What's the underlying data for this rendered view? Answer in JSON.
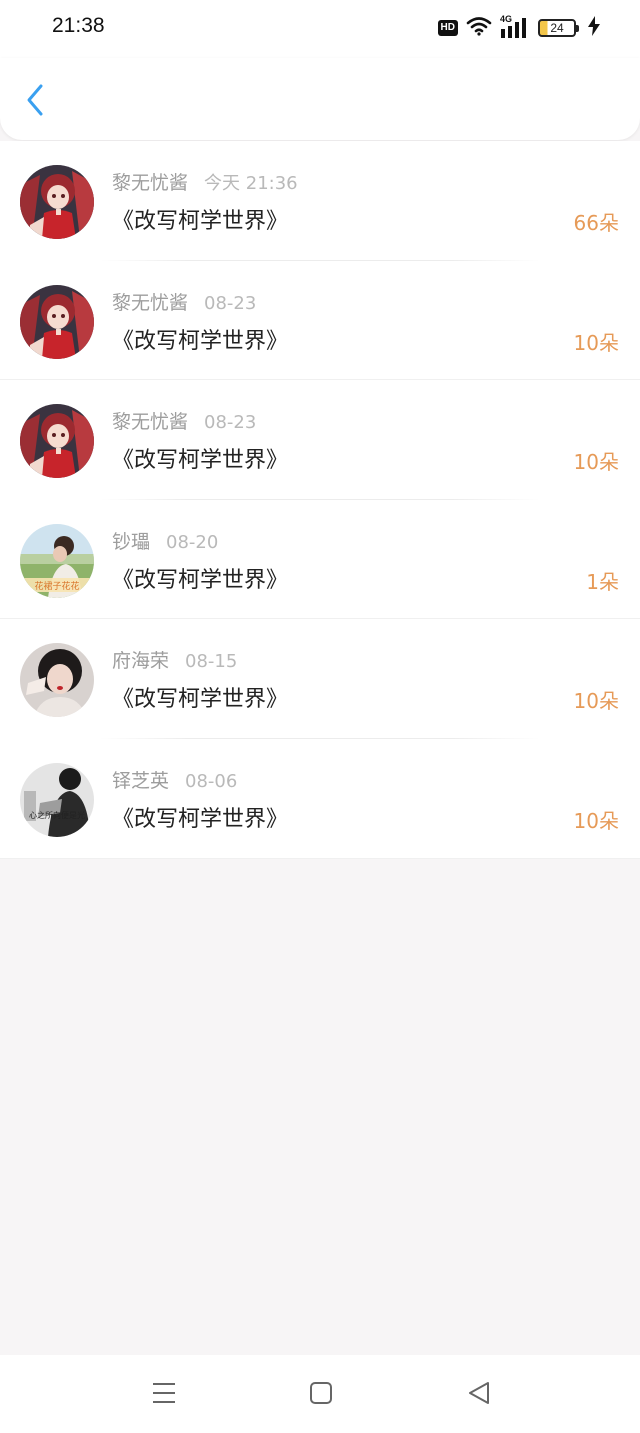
{
  "status_bar": {
    "time": "21:38",
    "hd_label": "HD",
    "network_label": "4G",
    "battery_level": "24",
    "icons": [
      "hd-icon",
      "wifi-icon",
      "signal-4g-icon",
      "battery-icon",
      "charging-bolt-icon"
    ]
  },
  "header": {
    "back_icon": "chevron-left-icon",
    "accent_color": "#3aa0f0"
  },
  "colors": {
    "amount": "#e69a57",
    "meta_text": "#9d9d9d",
    "background": "#f7f5f6"
  },
  "rows": [
    {
      "name": "黎无忧酱",
      "date": "今天 21:36",
      "title": "《改写柯学世界》",
      "amount": "66朵",
      "avatar": "avatar-anime-red"
    },
    {
      "name": "黎无忧酱",
      "date": "08-23",
      "title": "《改写柯学世界》",
      "amount": "10朵",
      "avatar": "avatar-anime-red"
    },
    {
      "name": "黎无忧酱",
      "date": "08-23",
      "title": "《改写柯学世界》",
      "amount": "10朵",
      "avatar": "avatar-anime-red"
    },
    {
      "name": "钞瓃",
      "date": "08-20",
      "title": "《改写柯学世界》",
      "amount": "1朵",
      "avatar": "avatar-photo-girl-outdoor",
      "avatar_caption": "花裙子花花"
    },
    {
      "name": "府海荣",
      "date": "08-15",
      "title": "《改写柯学世界》",
      "amount": "10朵",
      "avatar": "avatar-photo-girl-dark"
    },
    {
      "name": "铎芝英",
      "date": "08-06",
      "title": "《改写柯学世界》",
      "amount": "10朵",
      "avatar": "avatar-photo-bw",
      "avatar_caption": "心之所向便是光"
    }
  ],
  "nav_bar": {
    "icons": [
      "menu-icon",
      "home-square-icon",
      "back-triangle-icon"
    ]
  }
}
